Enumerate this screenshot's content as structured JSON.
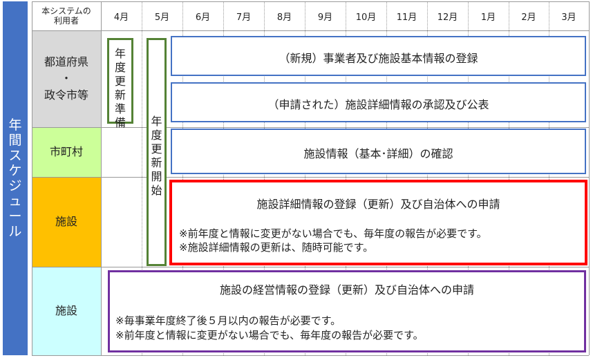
{
  "side_label": [
    "年",
    "間",
    "ス",
    "ケ",
    "ジ",
    "ュ",
    "ー",
    "ル"
  ],
  "header": {
    "corner": [
      "本システムの",
      "利用者"
    ],
    "months": [
      "4月",
      "5月",
      "6月",
      "7月",
      "8月",
      "9月",
      "10月",
      "11月",
      "12月",
      "1月",
      "2月",
      "3月"
    ]
  },
  "rows": {
    "pref": [
      "都道府県",
      "・",
      "政令市等"
    ],
    "city": "市町村",
    "facility1": "施設",
    "facility2": "施設"
  },
  "vertical_boxes": {
    "prep": [
      "年",
      "度",
      "更",
      "新",
      "準",
      "備"
    ],
    "start": [
      "年",
      "度",
      "更",
      "新",
      "開",
      "始"
    ]
  },
  "boxes": {
    "register_basic": "（新規）事業者及び施設基本情報の登録",
    "approve_detail": "（申請された）施設詳細情報の承認及び公表",
    "confirm": "施設情報（基本･詳細）の確認",
    "detail_apply": {
      "title": "施設詳細情報の登録（更新）及び自治体への申請",
      "note1": "※前年度と情報に変更がない場合でも、毎年度の報告が必要です。",
      "note2": "※施設詳細情報の更新は、随時可能です。"
    },
    "management_apply": {
      "title": "施設の経営情報の登録（更新）及び自治体への申請",
      "note1": "※毎事業年度終了後５月以内の報告が必要です。",
      "note2": "※前年度と情報に変更がない場合でも、毎年度の報告が必要です。"
    }
  },
  "colors": {
    "side": "#4472c4",
    "pref_bg": "#d9d9d9",
    "city_bg": "#ccff99",
    "facility1_bg": "#ffc000",
    "facility2_bg": "#ccffff",
    "blue_border": "#4472c4",
    "red_border": "#ff0000",
    "purple_border": "#7030a0",
    "green_border": "#548235"
  }
}
